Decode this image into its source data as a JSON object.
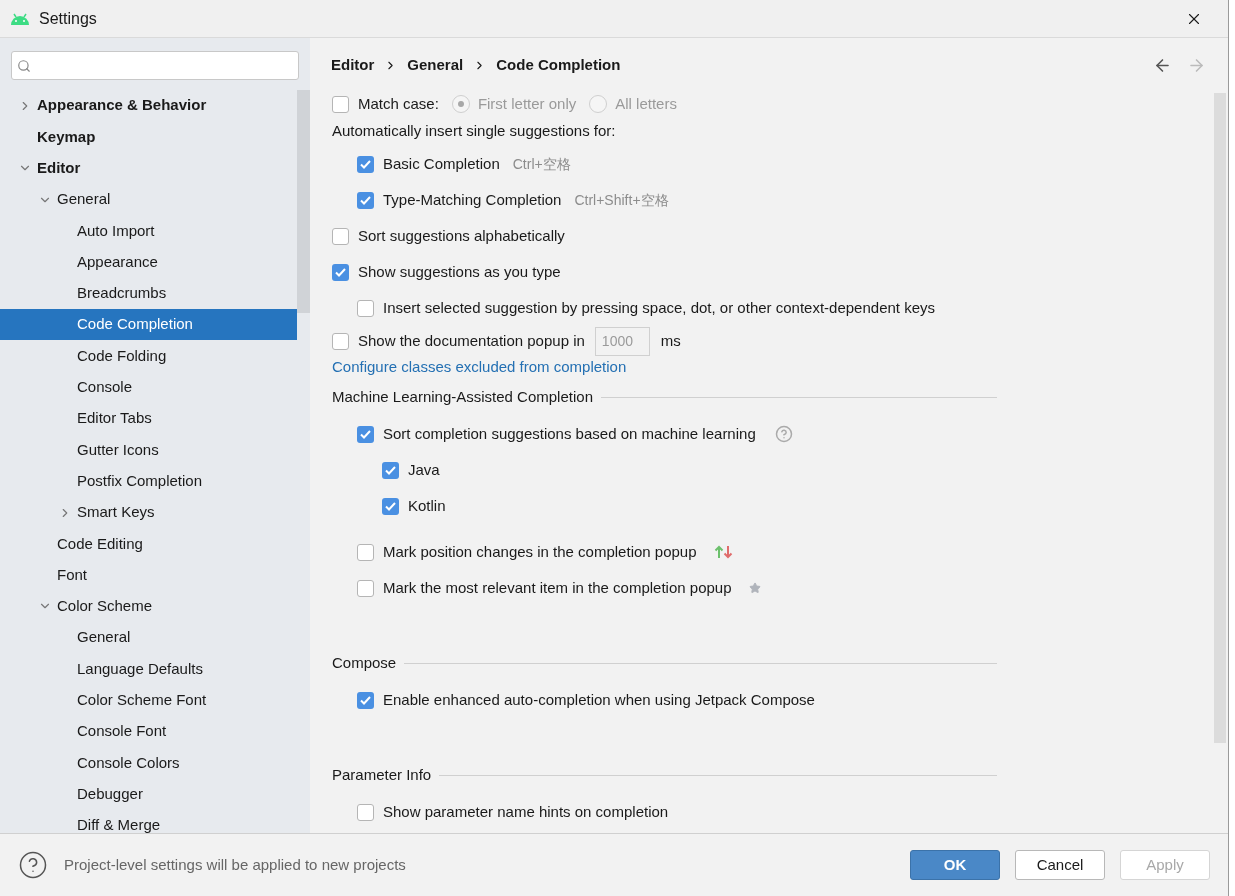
{
  "window": {
    "title": "Settings"
  },
  "sidebar": {
    "items": [
      {
        "label": "Appearance & Behavior",
        "expanded": false,
        "selected": false
      },
      {
        "label": "Keymap",
        "selected": false
      },
      {
        "label": "Editor",
        "expanded": true,
        "selected": false,
        "children": [
          {
            "label": "General",
            "expanded": true,
            "selected": false,
            "children": [
              {
                "label": "Auto Import",
                "selected": false
              },
              {
                "label": "Appearance",
                "selected": false
              },
              {
                "label": "Breadcrumbs",
                "selected": false
              },
              {
                "label": "Code Completion",
                "selected": true
              },
              {
                "label": "Code Folding",
                "selected": false
              },
              {
                "label": "Console",
                "selected": false
              },
              {
                "label": "Editor Tabs",
                "selected": false
              },
              {
                "label": "Gutter Icons",
                "selected": false
              },
              {
                "label": "Postfix Completion",
                "selected": false
              },
              {
                "label": "Smart Keys",
                "expanded": false,
                "selected": false
              }
            ]
          },
          {
            "label": "Code Editing",
            "selected": false
          },
          {
            "label": "Font",
            "selected": false
          },
          {
            "label": "Color Scheme",
            "expanded": true,
            "selected": false,
            "children": [
              {
                "label": "General",
                "selected": false
              },
              {
                "label": "Language Defaults",
                "selected": false
              },
              {
                "label": "Color Scheme Font",
                "selected": false
              },
              {
                "label": "Console Font",
                "selected": false
              },
              {
                "label": "Console Colors",
                "selected": false
              },
              {
                "label": "Debugger",
                "selected": false
              },
              {
                "label": "Diff & Merge",
                "selected": false
              }
            ]
          }
        ]
      }
    ]
  },
  "breadcrumb": [
    "Editor",
    "General",
    "Code Completion"
  ],
  "nav": {
    "back_enabled": true,
    "forward_enabled": false
  },
  "content": [
    {
      "kind": "match_case",
      "label": "Match case:",
      "checked": false,
      "radios": [
        {
          "label": "First letter only",
          "selected": true
        },
        {
          "label": "All letters",
          "selected": false
        }
      ]
    },
    {
      "kind": "label",
      "label": "Automatically insert single suggestions for:",
      "children": [
        {
          "kind": "checkbox",
          "label": "Basic Completion",
          "checked": true,
          "shortcut": "Ctrl+空格"
        },
        {
          "kind": "checkbox",
          "label": "Type-Matching Completion",
          "checked": true,
          "shortcut": "Ctrl+Shift+空格"
        }
      ]
    },
    {
      "kind": "checkbox",
      "label": "Sort suggestions alphabetically",
      "checked": false
    },
    {
      "kind": "checkbox",
      "label": "Show suggestions as you type",
      "checked": true,
      "children": [
        {
          "kind": "checkbox",
          "label": "Insert selected suggestion by pressing space, dot, or other context-dependent keys",
          "checked": false
        }
      ]
    },
    {
      "kind": "field_row",
      "label": "Show the documentation popup in",
      "checked": false,
      "value": "1000",
      "unit": "ms",
      "disabled": true
    },
    {
      "kind": "link",
      "label": "Configure classes excluded from completion"
    },
    {
      "kind": "section",
      "label": "Machine Learning-Assisted Completion",
      "children": [
        {
          "kind": "checkbox_help",
          "label": "Sort completion suggestions based on machine learning",
          "checked": true,
          "children": [
            {
              "kind": "checkbox",
              "label": "Java",
              "checked": true
            },
            {
              "kind": "checkbox",
              "label": "Kotlin",
              "checked": true
            }
          ]
        },
        {
          "kind": "checkbox_arrows",
          "label": "Mark position changes in the completion popup",
          "checked": false
        },
        {
          "kind": "checkbox_star",
          "label": "Mark the most relevant item in the completion popup",
          "checked": false
        }
      ]
    },
    {
      "kind": "section",
      "label": "Compose",
      "children": [
        {
          "kind": "checkbox",
          "label": "Enable enhanced auto-completion when using Jetpack Compose",
          "checked": true
        }
      ]
    },
    {
      "kind": "section",
      "label": "Parameter Info",
      "children": [
        {
          "kind": "checkbox",
          "label": "Show parameter name hints on completion",
          "checked": false
        }
      ]
    }
  ],
  "footer": {
    "hint": "Project-level settings will be applied to new projects",
    "buttons": [
      {
        "label": "OK",
        "kind": "primary",
        "disabled": false
      },
      {
        "label": "Cancel",
        "kind": "default",
        "disabled": false
      },
      {
        "label": "Apply",
        "kind": "default",
        "disabled": true
      }
    ]
  }
}
